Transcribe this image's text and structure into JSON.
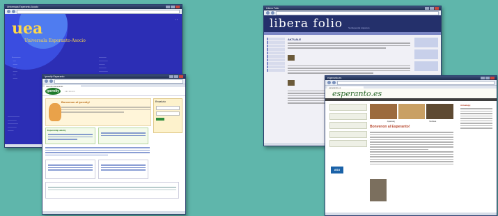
{
  "windows": {
    "uea": {
      "title": "Universala Esperanto-Asocio",
      "logo": "uea",
      "subtitle": "Universala Esperanto-Asocio",
      "bg_color": "#2c2eb5"
    },
    "ipernity": {
      "title": "Ipernity Esperanto",
      "logo": "ipernity",
      "welcome": "Bonvenon al ipernity!",
      "login_title": "Ensalutu",
      "footer_note": "Esperantaj sekcioj"
    },
    "liberafolio": {
      "title": "Libera Folio",
      "banner_title": "libera folio",
      "banner_sub": "Sendependa retgazeto",
      "section": "AKTUALE"
    },
    "esperanto_es": {
      "title": "esperanto.es",
      "site_title": "esperanto.es",
      "welcome": "Bonvenon al Esperanto!",
      "photo_labels": [
        "Aparatoj",
        "Notikas"
      ],
      "right_header": "Aktualaĵoj",
      "badge": "ASU"
    }
  },
  "colors": {
    "desktop": "#5fb6ab",
    "titlebar": "#1f2d4f",
    "uea_blue": "#2c2eb5",
    "uea_yellow": "#ffd84a",
    "libera_navy": "#24306b",
    "espes_green": "#2d6a2d"
  }
}
